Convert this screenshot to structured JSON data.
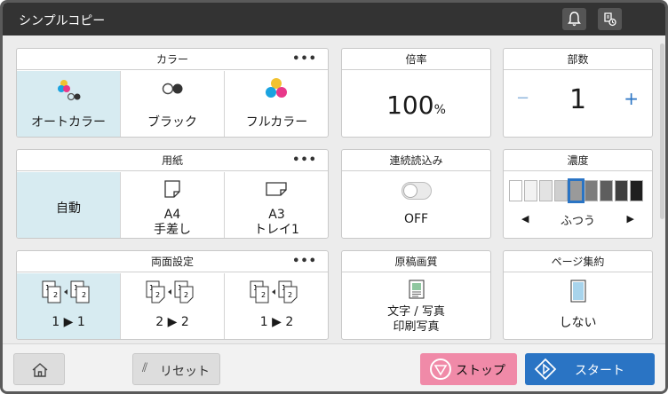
{
  "title": "シンプルコピー",
  "header": {
    "bell_icon": "bell-icon",
    "job_icon": "job-status-icon"
  },
  "color": {
    "heading": "カラー",
    "more": "•••",
    "options": [
      {
        "label": "オートカラー",
        "icon": "auto-color-icon",
        "selected": true
      },
      {
        "label": "ブラック",
        "icon": "black-icon",
        "selected": false
      },
      {
        "label": "フルカラー",
        "icon": "full-color-icon",
        "selected": false
      }
    ]
  },
  "zoom": {
    "heading": "倍率",
    "value": "100",
    "unit": "%"
  },
  "copies": {
    "heading": "部数",
    "minus": "−",
    "value": "1",
    "plus": "+"
  },
  "paper": {
    "heading": "用紙",
    "more": "•••",
    "options": [
      {
        "label": "自動",
        "selected": true
      },
      {
        "line1": "A4",
        "line2": "手差し",
        "selected": false
      },
      {
        "line1": "A3",
        "line2": "トレイ1",
        "selected": false
      }
    ]
  },
  "continuous": {
    "heading": "連続読込み",
    "state": "OFF"
  },
  "density": {
    "heading": "濃度",
    "value": "ふつう",
    "left": "◀",
    "right": "▶",
    "level": 5,
    "steps": 9
  },
  "duplex": {
    "heading": "両面設定",
    "more": "•••",
    "options": [
      {
        "left": "1",
        "arrow": "▶",
        "right": "1",
        "selected": true
      },
      {
        "left": "2",
        "arrow": "▶",
        "right": "2",
        "selected": false
      },
      {
        "left": "1",
        "arrow": "▶",
        "right": "2",
        "selected": false
      }
    ]
  },
  "quality": {
    "heading": "原稿画質",
    "line1": "文字 / 写真",
    "line2": "印刷写真"
  },
  "combine": {
    "heading": "ページ集約",
    "value": "しない"
  },
  "footer": {
    "home_icon": "home-icon",
    "reset": "リセット",
    "stop": "ストップ",
    "start": "スタート"
  },
  "colors": {
    "accent": "#2a74c4",
    "stop": "#f08aa8",
    "selected": "#d7ebf1"
  }
}
